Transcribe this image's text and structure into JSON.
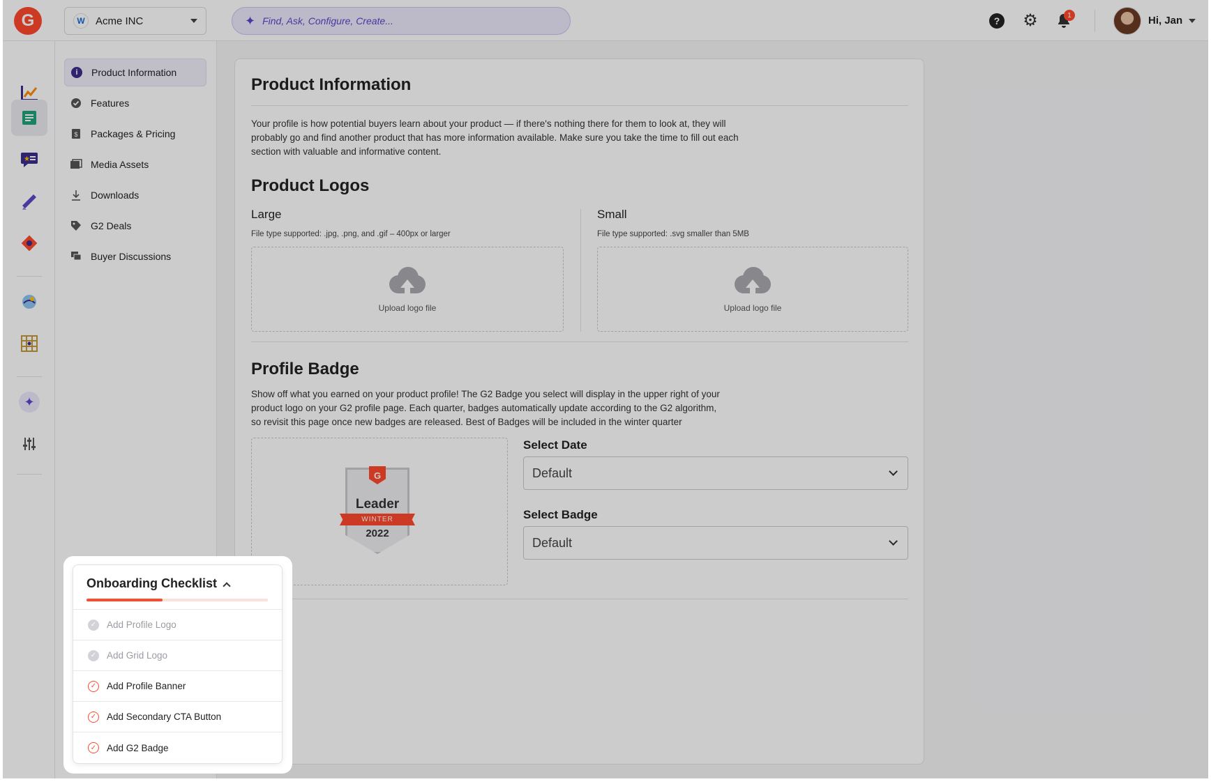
{
  "topbar": {
    "logo_text": "G",
    "org": {
      "logo_letter": "W",
      "name": "Acme INC"
    },
    "search": {
      "placeholder": "Find, Ask, Configure, Create..."
    },
    "notifications_count": "1",
    "greeting": "Hi, Jan"
  },
  "rail": {
    "items": [
      {
        "icon": "analytics-icon",
        "active": false
      },
      {
        "icon": "profile-icon",
        "active": true
      },
      {
        "icon": "reviews-icon",
        "active": false
      },
      {
        "icon": "marketing-icon",
        "active": false
      },
      {
        "icon": "integrations-icon",
        "active": false
      },
      {
        "icon": "intent-icon",
        "active": false
      },
      {
        "icon": "grid-icon",
        "active": false
      },
      {
        "icon": "ai-sparkle-icon",
        "active": false
      },
      {
        "icon": "settings-sliders-icon",
        "active": false
      }
    ]
  },
  "section_nav": {
    "items": [
      {
        "label": "Product Information",
        "icon": "info-icon",
        "active": true
      },
      {
        "label": "Features",
        "icon": "badge-check-icon",
        "active": false
      },
      {
        "label": "Packages & Pricing",
        "icon": "price-doc-icon",
        "active": false
      },
      {
        "label": "Media Assets",
        "icon": "media-icon",
        "active": false
      },
      {
        "label": "Downloads",
        "icon": "download-icon",
        "active": false
      },
      {
        "label": "G2 Deals",
        "icon": "tag-icon",
        "active": false
      },
      {
        "label": "Buyer Discussions",
        "icon": "discussion-icon",
        "active": false
      }
    ]
  },
  "main": {
    "title": "Product Information",
    "intro": [
      "Your profile is how potential buyers learn about your product — if there's nothing there for them to look at, they will",
      "probably go and find another product that has more information available. Make sure you take the time to fill out each",
      "section with valuable and informative content."
    ],
    "logos": {
      "title": "Product Logos",
      "large": {
        "label": "Large",
        "hint": "File type supported: .jpg, .png, and .gif – 400px or larger",
        "upload_label": "Upload logo file"
      },
      "small": {
        "label": "Small",
        "hint": "File type supported: .svg smaller than 5MB",
        "upload_label": "Upload logo file"
      }
    },
    "badge": {
      "title": "Profile Badge",
      "description": [
        "Show off what you earned on your product profile! The G2 Badge you select will display in the upper right of your",
        "product logo on your G2 profile page.  Each quarter, badges automatically update according to the G2 algorithm,",
        "so revisit this page once new badges are released. Best of Badges will be included in the winter quarter"
      ],
      "preview": {
        "logo_text": "G",
        "title": "Leader",
        "season": "WINTER",
        "year": "2022"
      },
      "select_date": {
        "label": "Select Date",
        "value": "Default"
      },
      "select_badge": {
        "label": "Select Badge",
        "value": "Default"
      }
    }
  },
  "checklist": {
    "title": "Onboarding Checklist",
    "progress": 0.42,
    "items": [
      {
        "label": "Add Profile Logo",
        "done": true
      },
      {
        "label": "Add Grid Logo",
        "done": true
      },
      {
        "label": "Add Profile Banner",
        "done": false
      },
      {
        "label": "Add Secondary CTA Button",
        "done": false
      },
      {
        "label": "Add G2 Badge",
        "done": false
      }
    ]
  },
  "colors": {
    "brand": "#ff492c",
    "accent": "#5a46c9",
    "nav_active": "#3d2c8d"
  }
}
